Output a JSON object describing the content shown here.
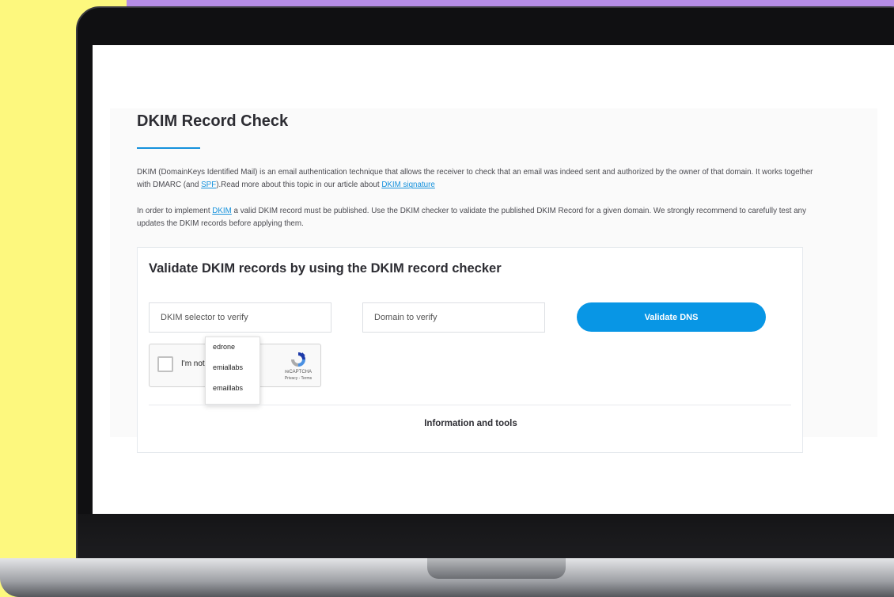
{
  "page": {
    "title": "DKIM Record Check",
    "intro": {
      "text1": "DKIM (DomainKeys Identified Mail) is an email authentication technique that allows the receiver to check that an email was indeed sent and authorized by the owner of that domain. It works together with DMARC (and ",
      "link1": "SPF",
      "text2": ").Read more about this topic in our article about ",
      "link2": "DKIM signature"
    },
    "second": {
      "text1": "In order to implement ",
      "link1": "DKIM",
      "text2": " a valid DKIM record must be published. Use the DKIM checker to validate the published DKIM Record for a given domain. We strongly recommend to carefully test any updates the DKIM records before applying them."
    }
  },
  "card": {
    "title": "Validate DKIM records by using the DKIM record checker",
    "selector_placeholder": "DKIM selector to verify",
    "domain_placeholder": "Domain to verify",
    "validate_label": "Validate DNS",
    "captcha": {
      "label": "I'm not",
      "brand": "reCAPTCHA",
      "links": "Privacy - Terms"
    },
    "autocomplete": [
      "edrone",
      "emiallabs",
      "emaillabs"
    ],
    "info_title": "Information and tools"
  },
  "colors": {
    "accent": "#0896e5",
    "link": "#1591dc",
    "background_yellow": "#fdf87e",
    "background_purple": "#b68de6"
  }
}
